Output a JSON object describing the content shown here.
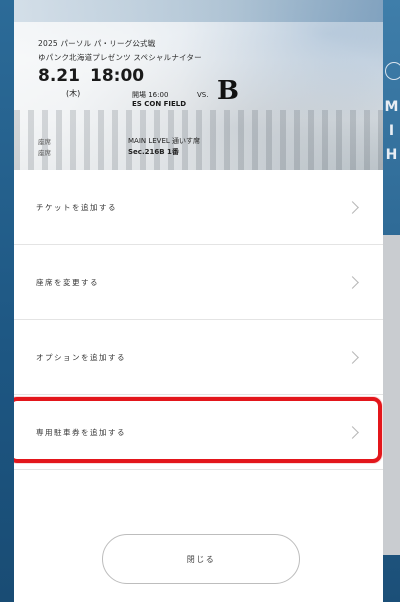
{
  "game": {
    "league": "2025 パーソル パ・リーグ公式戦",
    "event_title": "ゆパンク北海道プレゼンツ スペシャルナイター",
    "date": "8.21",
    "day_of_week": "(木)",
    "time": "18:00",
    "open_time": "開場 16:00",
    "venue": "ES CON FIELD",
    "vs": "VS.",
    "opponent_logo": "B",
    "seat_label": "座席",
    "seat_label2": "座席",
    "seat_level": "MAIN LEVEL 通いす席",
    "seat_number": "Sec.216B    1番"
  },
  "menu": {
    "items": [
      {
        "label": "チケットを追加する",
        "icon": "chevron-right-icon"
      },
      {
        "label": "座席を変更する",
        "icon": "chevron-right-icon"
      },
      {
        "label": "オプションを追加する",
        "icon": "chevron-right-icon"
      },
      {
        "label": "専用駐車券を追加する",
        "icon": "chevron-right-icon"
      }
    ]
  },
  "background": {
    "peek_text": "M I H"
  },
  "close_button": {
    "label": "閉じる"
  },
  "colors": {
    "highlight": "#e3161b",
    "sheet": "#ffffff",
    "background": "#1f5a86"
  }
}
